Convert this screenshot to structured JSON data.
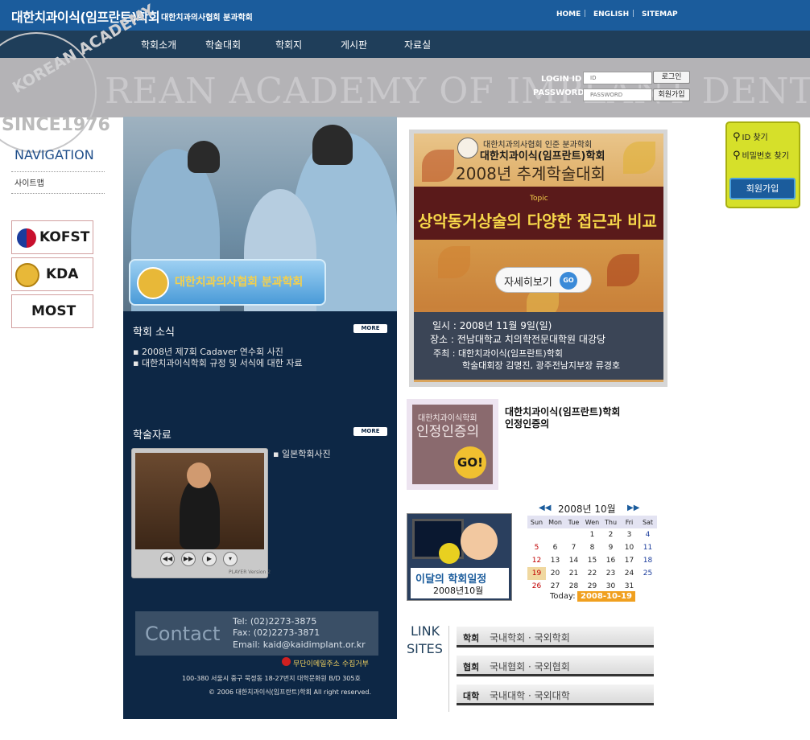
{
  "header": {
    "title": "대한치과이식(임프란트)학회",
    "subtitle": "대한치과의사협회 분과학회",
    "links": [
      "HOME",
      "ENGLISH",
      "SITEMAP"
    ]
  },
  "menu": [
    "학회소개",
    "학술대회",
    "학회지",
    "게시판",
    "자료실"
  ],
  "banner": {
    "watermark": "REAN ACADEMY OF IMPLANT DENTISTRY",
    "seal_text": "KOREAN ACADEMY",
    "since": "SINCE1976"
  },
  "login": {
    "id_label": "LOGIN ID",
    "password_label": "PASSWORD",
    "id_placeholder": "ID",
    "password_placeholder": "PASSWORD",
    "login_button": "로그인",
    "join_button": "회원가입"
  },
  "sidebar": {
    "nav_title": "NAVIGATION",
    "sitemap": "사이트맵",
    "logos": [
      "KOFST",
      "KDA",
      "MOST"
    ]
  },
  "photo_banner": {
    "text": "대한치과의사협회 분과학회"
  },
  "news": {
    "title": "학회 소식",
    "more": "MORE",
    "items": [
      "2008년 제7회 Cadaver 연수회 사진",
      "대한치과이식학회 규정 및 서식에 대한 자료"
    ]
  },
  "academic": {
    "title": "학술자료",
    "more": "MORE",
    "items": [
      "일본학회사진"
    ],
    "player_label": "PLAYER Version 2"
  },
  "contact": {
    "title": "Contact",
    "tel": "Tel: (02)2273-3875",
    "fax": "Fax: (02)2273-3871",
    "email": "Email: kaid@kaidimplant.or.kr",
    "spam": "무단이메일주소 수집거부",
    "address": "100-380 서울시 중구 묵정동 18-27번지 대학문화원 B/D 305호",
    "copyright": "© 2006 대한치과이식(임프란트)학회 All right reserved."
  },
  "poster": {
    "org_line1": "대한치과의사협회 인준 분과학회",
    "org_line2": "대한치과이식(임프란트)학회",
    "title": "2008년 추계학술대회",
    "topic_label": "Topic",
    "topic": "상악동거상술의 다양한 접근과 비교",
    "detail_button": "자세히보기",
    "go": "GO",
    "date": "일시 : 2008년 11월 9일(일)",
    "place": "장소 : 전남대학교 치의학전문대학원 대강당",
    "host_line1": "주최 : 대한치과이식(임프란트)학회",
    "host_line2": "학술대회장 김명진, 광주전남지부장 류경호"
  },
  "certification": {
    "box_line1": "대한치과이식학회",
    "box_line2": "인정인증의",
    "go": "GO!",
    "desc_line1": "대한치과이식(임프란트)학회",
    "desc_line2": "인정인증의"
  },
  "schedule": {
    "label": "이달의 학회일정",
    "month": "2008년10월"
  },
  "calendar": {
    "header": "2008년 10월",
    "days_of_week": [
      "Sun",
      "Mon",
      "Tue",
      "Wen",
      "Thu",
      "Fri",
      "Sat"
    ],
    "weeks": [
      [
        "",
        "",
        "",
        "1",
        "2",
        "3",
        "4"
      ],
      [
        "5",
        "6",
        "7",
        "8",
        "9",
        "10",
        "11"
      ],
      [
        "12",
        "13",
        "14",
        "15",
        "16",
        "17",
        "18"
      ],
      [
        "19",
        "20",
        "21",
        "22",
        "23",
        "24",
        "25"
      ],
      [
        "26",
        "27",
        "28",
        "29",
        "30",
        "31",
        ""
      ]
    ],
    "today_label": "Today:",
    "today": "2008-10-19",
    "colors": {
      "sunday": "#c00000",
      "saturday": "#1b3c9c",
      "today_bg": "#f0d8a0"
    }
  },
  "link_sites": {
    "title_line1": "LINK",
    "title_line2": "SITES",
    "items": [
      {
        "cat": "학회",
        "text": "국내학회 · 국외학회"
      },
      {
        "cat": "협회",
        "text": "국내협회 · 국외협회"
      },
      {
        "cat": "대학",
        "text": "국내대학 · 국외대학"
      }
    ]
  },
  "find": {
    "id": "ID 찾기",
    "password": "비밀번호 찾기",
    "join": "회원가입"
  },
  "colors": {
    "brand_blue": "#1b5c9c",
    "navy": "#0d2745",
    "menu_bg": "#1f3e5a",
    "find_box": "#d6e02a"
  }
}
